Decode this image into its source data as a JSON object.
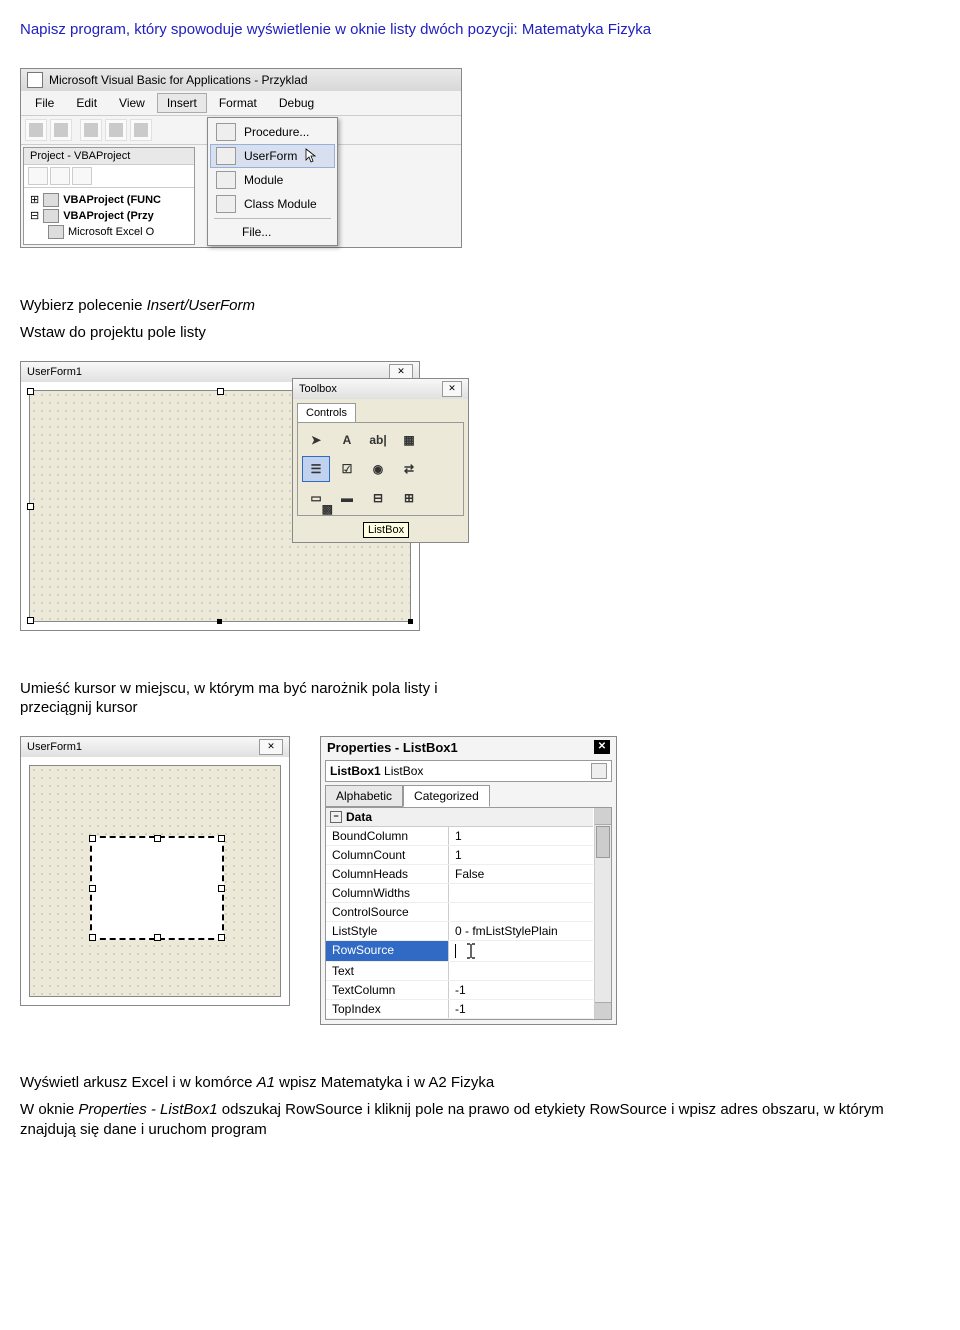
{
  "instruction": "Napisz program, który spowoduje wyświetlenie w oknie listy dwóch pozycji: Matematyka Fizyka",
  "vba": {
    "title": "Microsoft Visual Basic for Applications - Przyklad",
    "menus": {
      "file": "File",
      "edit": "Edit",
      "view": "View",
      "insert": "Insert",
      "format": "Format",
      "debug": "Debug"
    },
    "project_panel_title": "Project - VBAProject",
    "tree": {
      "item1": "VBAProject (FUNC",
      "item2": "VBAProject (Przy",
      "item3": "Microsoft Excel O"
    },
    "insert_menu": {
      "procedure": "Procedure...",
      "userform": "UserForm",
      "module": "Module",
      "classmodule": "Class Module",
      "file": "File..."
    }
  },
  "text1": "Wybierz polecenie ",
  "text1_italic": "Insert/UserForm",
  "text2": "Wstaw do projektu pole listy",
  "userform": {
    "title": "UserForm1"
  },
  "toolbox": {
    "title": "Toolbox",
    "tab": "Controls",
    "tooltip": "ListBox",
    "icons": {
      "ptr": "➤",
      "label": "A",
      "text": "ab|",
      "combo": "▦",
      "list": "☰",
      "check": "☑",
      "radio": "◉",
      "toggle": "⇄",
      "frame": "▭",
      "cmd": "▬",
      "tab": "⊟",
      "multi": "⊞",
      "scroll": "↕",
      "spin": "⇅",
      "img": "▩"
    }
  },
  "text3": "Umieść kursor w miejscu, w którym ma być narożnik pola listy i przeciągnij kursor",
  "props": {
    "title": "Properties - ListBox1",
    "combo_name": "ListBox1",
    "combo_type": "ListBox",
    "tab_alpha": "Alphabetic",
    "tab_cat": "Categorized",
    "cat_data": "Data",
    "rows": {
      "BoundColumn": "1",
      "ColumnCount": "1",
      "ColumnHeads": "False",
      "ColumnWidths": "",
      "ControlSource": "",
      "ListStyle": "0 - fmListStylePlain",
      "RowSource": "",
      "Text": "",
      "TextColumn": "-1",
      "TopIndex": "-1"
    }
  },
  "text4_l1": "Wyświetl arkusz Excel i w komórce ",
  "text4_i1": "A1",
  "text4_l2": " wpisz Matematyka i w A2 Fizyka",
  "text5_l1": "W oknie ",
  "text5_i1": "Properties - ListBox1",
  "text5_l2": " odszukaj RowSource i kliknij pole na prawo od etykiety RowSource i wpisz adres obszaru, w którym znajdują się dane i uruchom program"
}
